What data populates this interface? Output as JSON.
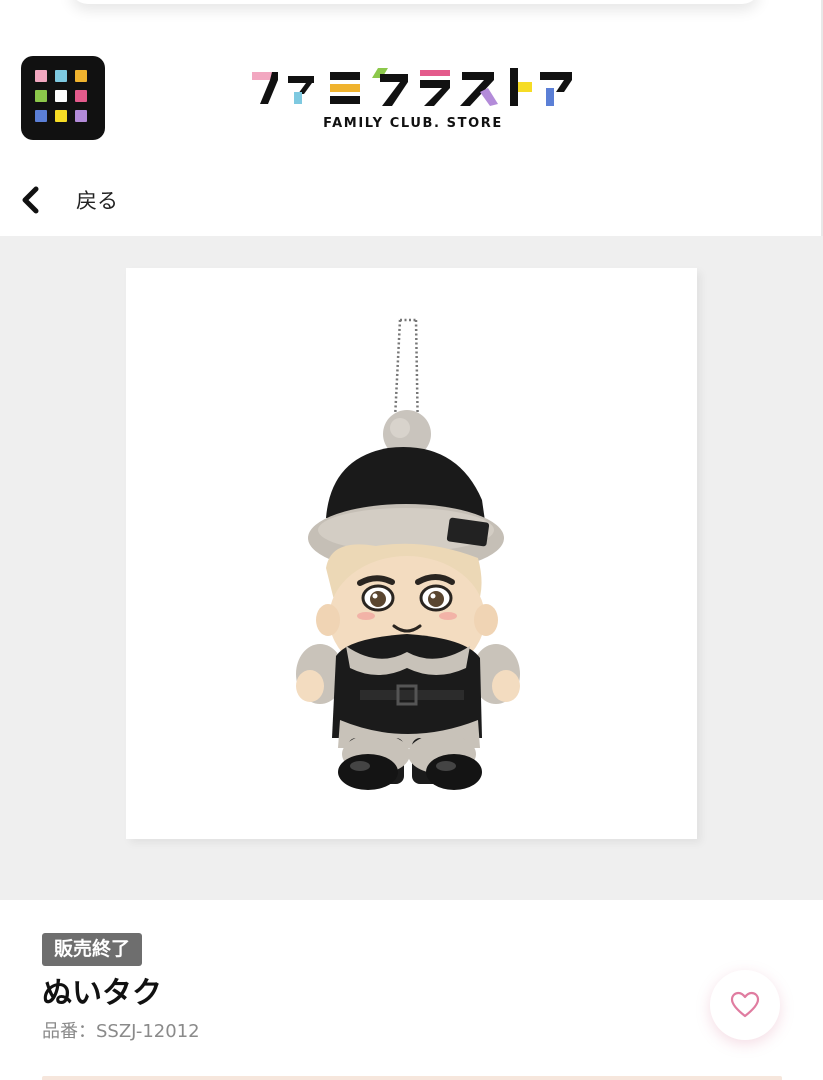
{
  "header": {
    "logo_text": "ファミクラストア",
    "logo_subtitle": "FAMILY CLUB. STORE",
    "menu_icon": "grid-menu-icon",
    "menu_colors": [
      "#f2a7c0",
      "#7ec9e0",
      "#f0b32e",
      "#8cc84b",
      "#ffffff",
      "#e45b8c",
      "#5b7fd6",
      "#f6dc25",
      "#b38bd9"
    ]
  },
  "nav": {
    "back_label": "戻る",
    "back_icon": "chevron-left-icon"
  },
  "product": {
    "image_subject": "plush-doll-keychain",
    "status": "販売終了",
    "name": "ぬいタク",
    "code": "品番：SSZJ-12012",
    "favorite_icon": "heart-icon"
  },
  "colors": {
    "gallery_bg": "#efefef",
    "badge_bg": "#6e6e6e",
    "heart": "#e07ca0"
  }
}
